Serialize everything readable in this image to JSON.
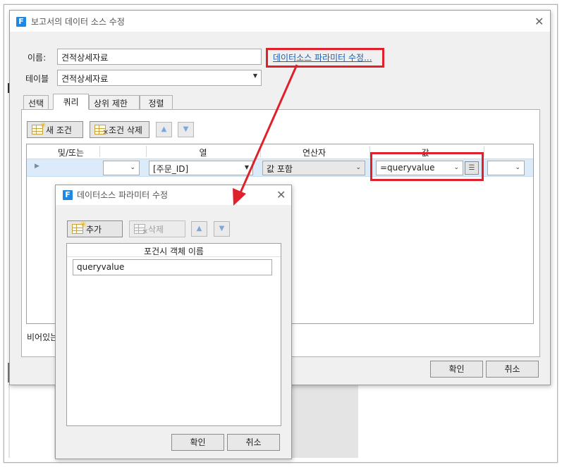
{
  "main_dialog": {
    "title": "보고서의 데이터 소스 수정",
    "close_glyph": "✕",
    "name_label": "이름:",
    "name_value": "견적상세자료",
    "param_link": "데이터소스 파라미터 수정...",
    "table_label": "테이블",
    "table_value": "견적상세자료",
    "tabs": [
      "선택",
      "쿼리",
      "상위 제한",
      "정렬"
    ],
    "toolbar": {
      "new_condition": "새 조건",
      "delete_condition": "조건 삭제"
    },
    "grid": {
      "headers": [
        "및/또는",
        "열",
        "연산자",
        "값"
      ],
      "row": {
        "andor": "",
        "column": "[주문_ID]",
        "operator": "값 포함",
        "value": "=queryvalue",
        "extra": ""
      }
    },
    "footer_text": "비어있는",
    "ok": "확인",
    "cancel": "취소"
  },
  "param_dialog": {
    "title": "데이터소스 파라미터 수정",
    "close_glyph": "✕",
    "add": "추가",
    "delete": "삭제",
    "header": "포건시 객체 이름",
    "value": "queryvalue",
    "ok": "확인",
    "cancel": "취소"
  },
  "colors": {
    "annotation_red": "#e0202a",
    "link_blue": "#1a5fb4",
    "selection": "#dcebfa",
    "brand_icon": "#1e88e5"
  },
  "icons": [
    "brand-f-icon",
    "close-icon",
    "new-condition-icon",
    "delete-condition-icon",
    "arrow-up-icon",
    "arrow-down-icon",
    "chevron-down-icon",
    "expression-builder-icon",
    "row-indicator-icon"
  ]
}
